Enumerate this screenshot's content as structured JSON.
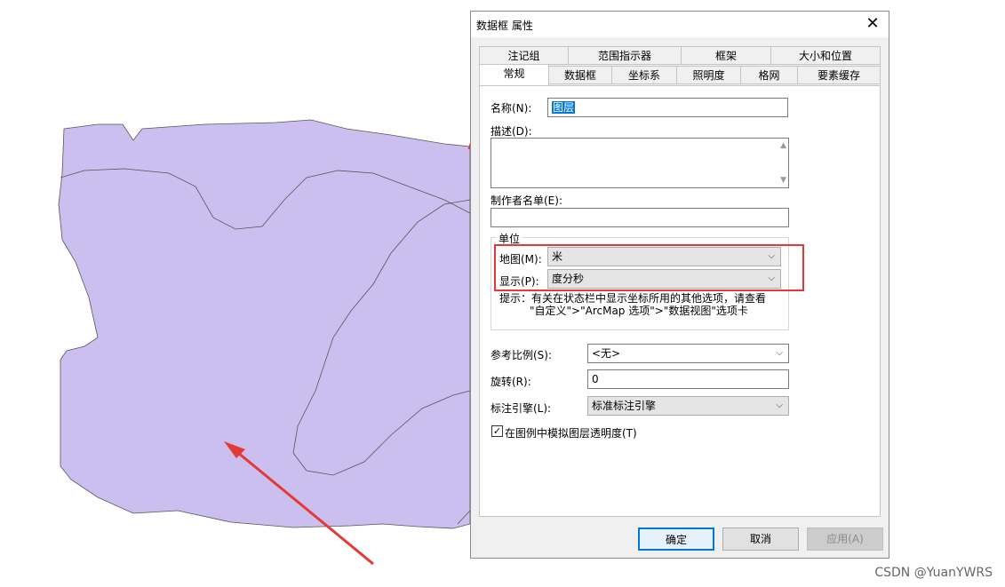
{
  "dialog": {
    "title": "数据框 属性",
    "close_glyph": "✕",
    "tabs_row1": [
      "注记组",
      "范围指示器",
      "框架",
      "大小和位置"
    ],
    "tabs_row2": [
      "常规",
      "数据框",
      "坐标系",
      "照明度",
      "格网",
      "要素缓存"
    ],
    "active_tab": "常规"
  },
  "general": {
    "name_label": "名称(N):",
    "name_value": "图层",
    "desc_label": "描述(D):",
    "desc_value": "",
    "credits_label": "制作者名单(E):",
    "credits_value": "",
    "units_group": "单位",
    "map_units_label": "地图(M):",
    "map_units_value": "米",
    "display_units_label": "显示(P):",
    "display_units_value": "度分秒",
    "hint_line1": "提示：有关在状态栏中显示坐标所用的其他选项，请查看",
    "hint_line2": "\"自定义\">\"ArcMap 选项\">\"数据视图\"选项卡",
    "ref_scale_label": "参考比例(S):",
    "ref_scale_value": "<无>",
    "rotation_label": "旋转(R):",
    "rotation_value": "0",
    "label_engine_label": "标注引擎(L):",
    "label_engine_value": "标准标注引擎",
    "simulate_transparency_label": "在图例中模拟图层透明度(T)",
    "simulate_transparency_checked": true,
    "check_glyph": "✓"
  },
  "buttons": {
    "ok": "确定",
    "cancel": "取消",
    "apply": "应用(A)"
  },
  "watermark": "CSDN @YuanYWRS",
  "colors": {
    "map_fill": "#cbbff0",
    "accent": "#0078d7",
    "highlight": "#e53935"
  }
}
